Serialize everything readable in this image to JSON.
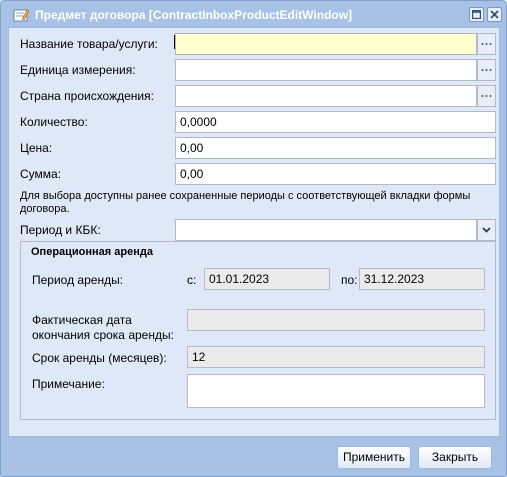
{
  "window": {
    "title": "Предмет договора [ContractInboxProductEditWindow]"
  },
  "form": {
    "product_label": "Название товара/услуги:",
    "product_value": "",
    "unit_label": "Единица измерения:",
    "unit_value": "",
    "country_label": "Страна происхождения:",
    "country_value": "",
    "quantity_label": "Количество:",
    "quantity_value": "0,0000",
    "price_label": "Цена:",
    "price_value": "0,00",
    "sum_label": "Сумма:",
    "sum_value": "0,00",
    "hint": "Для выбора доступны ранее сохраненные периоды с соответствующей вкладки формы договора.",
    "period_label": "Период и КБК:",
    "period_value": ""
  },
  "lease": {
    "legend": "Операционная аренда",
    "period_label": "Период аренды:",
    "from_label": "с:",
    "from_value": "01.01.2023",
    "to_label": "по:",
    "to_value": "31.12.2023",
    "actual_end_label": "Фактическая дата окончания срока аренды:",
    "actual_end_value": "",
    "term_label": "Срок аренды (месяцев):",
    "term_value": "12",
    "note_label": "Примечание:",
    "note_value": ""
  },
  "buttons": {
    "apply": "Применить",
    "close": "Закрыть"
  },
  "colors": {
    "window_frame": "#a7c2e4",
    "panel_bg": "#dfe8f6",
    "focus_field": "#ffffd0",
    "readonly_field": "#ebebeb"
  }
}
